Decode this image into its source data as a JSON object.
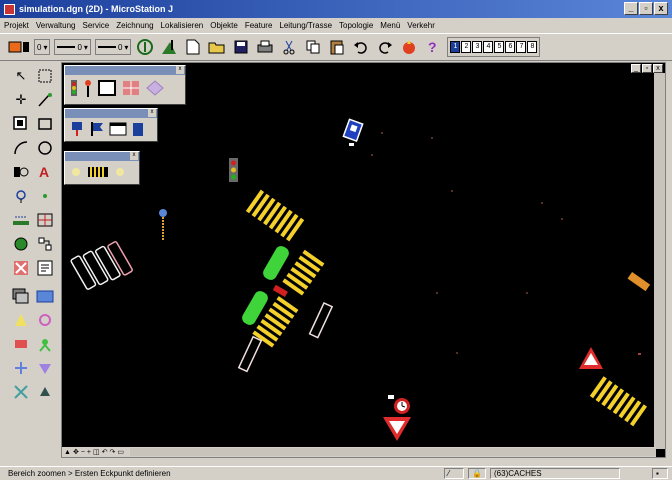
{
  "window": {
    "title": "simulation.dgn (2D) - MicroStation J",
    "min_label": "_",
    "restore_label": "▫",
    "close_label": "x"
  },
  "menu": [
    "Projekt",
    "Verwaltung",
    "Service",
    "Zeichnung",
    "Lokalisieren",
    "Objekte",
    "Feature",
    "Leitung/Trasse",
    "Topologie",
    "Menü",
    "Verkehr"
  ],
  "toolbar": {
    "color_label": "0",
    "style_label": "0",
    "weight_label": "0",
    "view_numbers": [
      "1",
      "2",
      "3",
      "4",
      "5",
      "6",
      "7",
      "8"
    ],
    "active_view": "1"
  },
  "canvas": {
    "min_label": "_",
    "restore_label": "▫",
    "close_label": "x"
  },
  "hscroll": {
    "controls": [
      "▲",
      "✥",
      "−",
      "+",
      "◫",
      "↶",
      "↷",
      "▭"
    ]
  },
  "status": {
    "message": "Bereich zoomen > Ersten Eckpunkt definieren",
    "lock_icon": "lock-icon",
    "cache_label": "(63)CACHES"
  },
  "colors": {
    "title_bar": "#1c3f9c",
    "canvas_bg": "#000000",
    "crosswalk": "#f4d02a",
    "tram": "#3fd43a",
    "sign_red": "#e02c2c"
  }
}
